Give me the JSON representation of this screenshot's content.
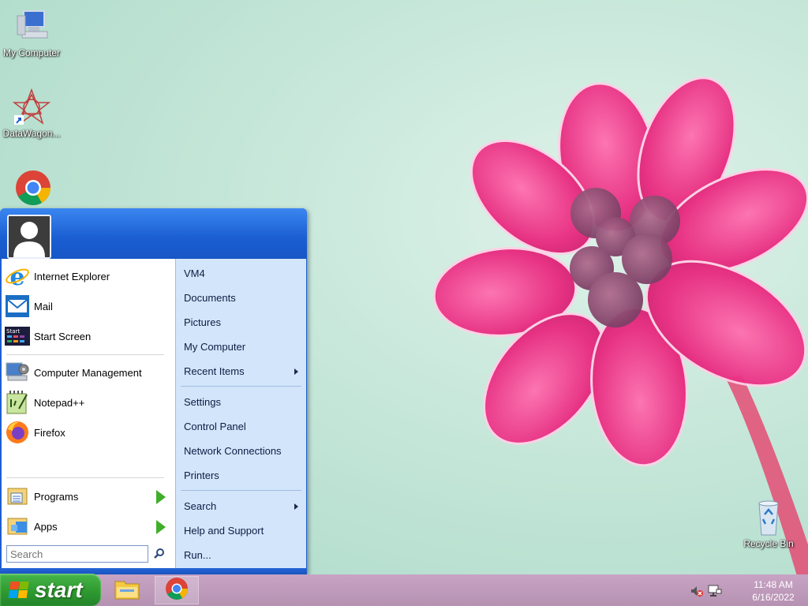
{
  "desktop": {
    "icons": [
      {
        "label": "My Computer",
        "icon": "computer-icon"
      },
      {
        "label": "DataWagon...",
        "icon": "datawagon-icon"
      },
      {
        "label": "",
        "icon": "chrome-shortcut-icon"
      },
      {
        "label": "Recycle Bin",
        "icon": "recycle-bin-icon"
      }
    ]
  },
  "start_menu": {
    "user_avatar": "user-avatar-icon",
    "pinned": [
      {
        "label": "Internet Explorer",
        "icon": "internet-explorer-icon"
      },
      {
        "label": "Mail",
        "icon": "mail-icon"
      },
      {
        "label": "Start Screen",
        "icon": "start-screen-icon"
      }
    ],
    "recent": [
      {
        "label": "Computer Management",
        "icon": "computer-management-icon"
      },
      {
        "label": "Notepad++",
        "icon": "notepad-plus-plus-icon"
      },
      {
        "label": "Firefox",
        "icon": "firefox-icon"
      }
    ],
    "programs_label": "Programs",
    "apps_label": "Apps",
    "search_placeholder": "Search",
    "right_items": {
      "vm4": "VM4",
      "documents": "Documents",
      "pictures": "Pictures",
      "my_computer": "My Computer",
      "recent_items": "Recent Items",
      "settings": "Settings",
      "control_panel": "Control Panel",
      "network_connections": "Network Connections",
      "printers": "Printers",
      "search": "Search",
      "help_and_support": "Help and Support",
      "run": "Run..."
    }
  },
  "taskbar": {
    "start_label": "start",
    "clock_time": "11:48 AM",
    "clock_date": "6/16/2022"
  },
  "colors": {
    "start_green": "#2f9a30",
    "menu_blue": "#1d5fd1",
    "taskbar": "#c29dbf"
  }
}
